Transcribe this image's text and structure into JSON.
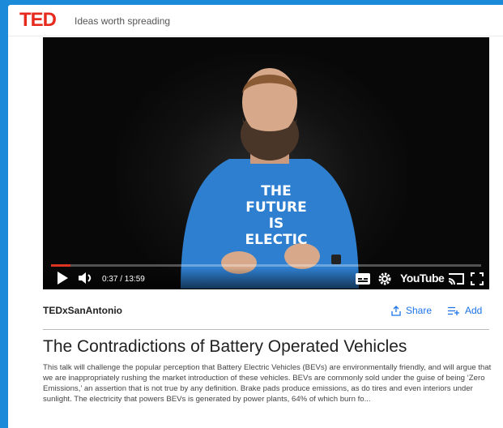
{
  "header": {
    "logo": "TED",
    "tagline": "Ideas worth spreading"
  },
  "video": {
    "shirt_text": [
      "THE",
      "FUTURE",
      "IS",
      "ELECTIC"
    ],
    "time_display": "0:37 / 13:59",
    "progress": 0.045,
    "youtube_label": "YouTube"
  },
  "talk": {
    "event": "TEDxSanAntonio",
    "share_label": "Share",
    "add_label": "Add",
    "title": "The Contradictions of Battery Operated Vehicles",
    "description": "This talk will challenge the popular perception that Battery Electric Vehicles (BEVs) are environmentally friendly, and will argue that we are inappropriately rushing the market introduction of these vehicles. BEVs are commonly sold under the guise of being ‘Zero Emissions,’ an assertion that is not true by any definition. Brake pads produce emissions, as do tires and even interiors under sunlight. The electricity that powers BEVs is generated by power plants, 64% of which burn fo..."
  },
  "colors": {
    "page_background": "#1b8ad8",
    "ted_red": "#e62b1e",
    "link_blue": "#1a73e8",
    "progress_red": "#dd3322",
    "shirt_blue": "#2f7fd0"
  },
  "icons": [
    "play-icon",
    "volume-icon",
    "subtitles-icon",
    "settings-icon",
    "cast-icon",
    "fullscreen-icon",
    "share-icon",
    "add-to-list-icon"
  ]
}
